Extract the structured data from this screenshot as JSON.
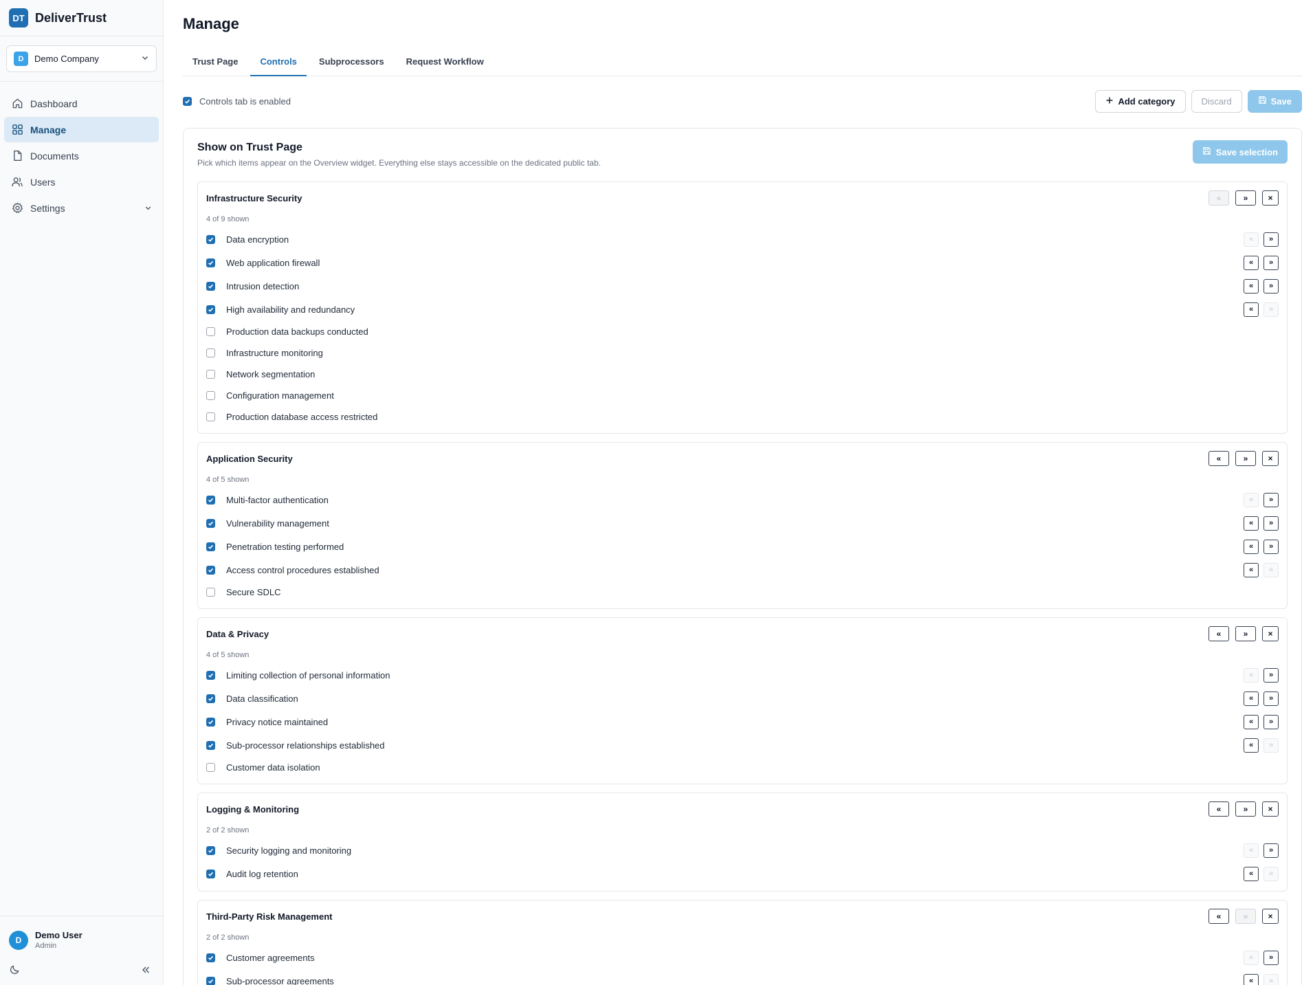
{
  "app": {
    "logo": "DT",
    "name": "DeliverTrust"
  },
  "company": {
    "badge": "D",
    "name": "Demo Company"
  },
  "nav": [
    {
      "label": "Dashboard",
      "icon": "home-icon",
      "active": false
    },
    {
      "label": "Manage",
      "icon": "grid-icon",
      "active": true
    },
    {
      "label": "Documents",
      "icon": "document-icon",
      "active": false
    },
    {
      "label": "Users",
      "icon": "users-icon",
      "active": false
    },
    {
      "label": "Settings",
      "icon": "gear-icon",
      "active": false,
      "expandable": true
    }
  ],
  "user": {
    "initial": "D",
    "name": "Demo User",
    "role": "Admin"
  },
  "page": {
    "title": "Manage"
  },
  "tabs": [
    {
      "label": "Trust Page",
      "active": false
    },
    {
      "label": "Controls",
      "active": true
    },
    {
      "label": "Subprocessors",
      "active": false
    },
    {
      "label": "Request Workflow",
      "active": false
    }
  ],
  "toolbar": {
    "enabled_label": "Controls tab is enabled",
    "enabled": true,
    "add_category": "Add category",
    "discard": "Discard",
    "save": "Save"
  },
  "panel": {
    "title": "Show on Trust Page",
    "description": "Pick which items appear on the Overview widget. Everything else stays accessible on the dedicated public tab.",
    "save_selection": "Save selection"
  },
  "categories": [
    {
      "title": "Infrastructure Security",
      "count": "4 of 9 shown",
      "up_disabled": true,
      "down_disabled": false,
      "items": [
        {
          "label": "Data encryption",
          "checked": true
        },
        {
          "label": "Web application firewall",
          "checked": true
        },
        {
          "label": "Intrusion detection",
          "checked": true
        },
        {
          "label": "High availability and redundancy",
          "checked": true
        },
        {
          "label": "Production data backups conducted",
          "checked": false
        },
        {
          "label": "Infrastructure monitoring",
          "checked": false
        },
        {
          "label": "Network segmentation",
          "checked": false
        },
        {
          "label": "Configuration management",
          "checked": false
        },
        {
          "label": "Production database access restricted",
          "checked": false
        }
      ]
    },
    {
      "title": "Application Security",
      "count": "4 of 5 shown",
      "up_disabled": false,
      "down_disabled": false,
      "items": [
        {
          "label": "Multi-factor authentication",
          "checked": true
        },
        {
          "label": "Vulnerability management",
          "checked": true
        },
        {
          "label": "Penetration testing performed",
          "checked": true
        },
        {
          "label": "Access control procedures established",
          "checked": true
        },
        {
          "label": "Secure SDLC",
          "checked": false
        }
      ]
    },
    {
      "title": "Data & Privacy",
      "count": "4 of 5 shown",
      "up_disabled": false,
      "down_disabled": false,
      "items": [
        {
          "label": "Limiting collection of personal information",
          "checked": true
        },
        {
          "label": "Data classification",
          "checked": true
        },
        {
          "label": "Privacy notice maintained",
          "checked": true
        },
        {
          "label": "Sub-processor relationships established",
          "checked": true
        },
        {
          "label": "Customer data isolation",
          "checked": false
        }
      ]
    },
    {
      "title": "Logging & Monitoring",
      "count": "2 of 2 shown",
      "up_disabled": false,
      "down_disabled": false,
      "items": [
        {
          "label": "Security logging and monitoring",
          "checked": true
        },
        {
          "label": "Audit log retention",
          "checked": true
        }
      ]
    },
    {
      "title": "Third-Party Risk Management",
      "count": "2 of 2 shown",
      "up_disabled": false,
      "down_disabled": true,
      "items": [
        {
          "label": "Customer agreements",
          "checked": true
        },
        {
          "label": "Sub-processor agreements",
          "checked": true
        }
      ]
    }
  ],
  "glyphs": {
    "up": "«",
    "down": "»",
    "remove": "×"
  },
  "colors": {
    "accent": "#1f6fb2",
    "save_button": "#8ec7eb",
    "active_nav_bg": "#dbeaf6"
  }
}
